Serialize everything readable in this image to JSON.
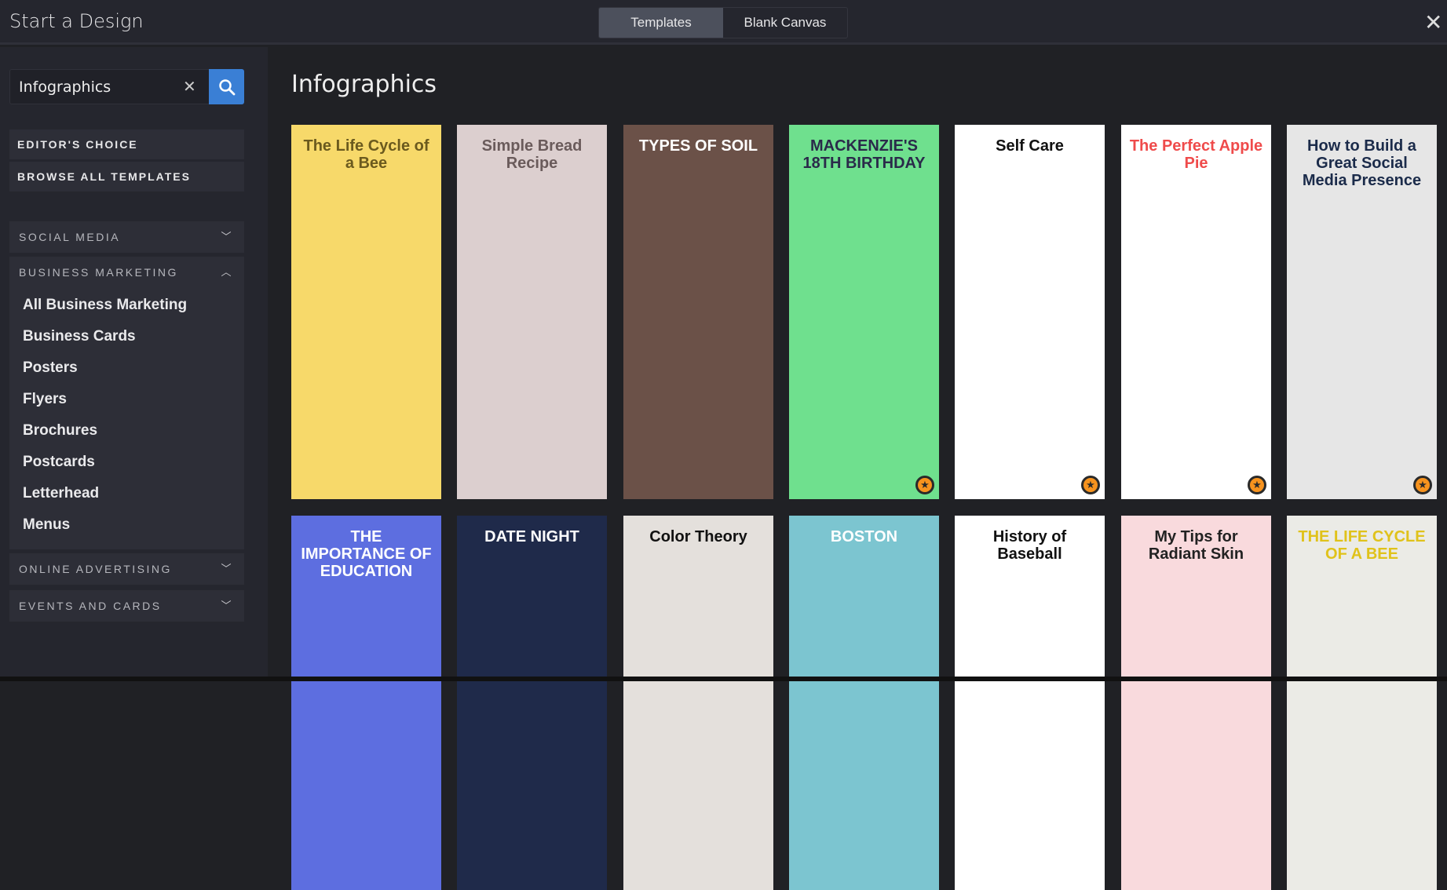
{
  "header": {
    "title": "Start a Design",
    "tabs": [
      {
        "label": "Templates",
        "active": true
      },
      {
        "label": "Blank Canvas",
        "active": false
      }
    ],
    "close": "✕"
  },
  "search": {
    "value": "Infographics",
    "clear": "✕"
  },
  "sidebar": {
    "editors_choice": "EDITOR'S CHOICE",
    "browse_all": "BROWSE ALL TEMPLATES",
    "sections": [
      {
        "label": "SOCIAL MEDIA",
        "expanded": false
      },
      {
        "label": "BUSINESS MARKETING",
        "expanded": true,
        "items": [
          "All Business Marketing",
          "Business Cards",
          "Posters",
          "Flyers",
          "Brochures",
          "Postcards",
          "Letterhead",
          "Menus"
        ]
      },
      {
        "label": "ONLINE ADVERTISING",
        "expanded": false
      },
      {
        "label": "EVENTS AND CARDS",
        "expanded": false
      }
    ]
  },
  "main": {
    "heading": "Infographics",
    "cards": [
      {
        "title": "The Life Cycle of a Bee",
        "bg": "#f7d96a",
        "fg": "#6b5a1e",
        "premium": false
      },
      {
        "title": "Simple Bread Recipe",
        "bg": "#dccfcf",
        "fg": "#6a5b5b",
        "premium": false
      },
      {
        "title": "TYPES OF SOIL",
        "bg": "#6b5148",
        "fg": "#ffffff",
        "premium": false
      },
      {
        "title": "MACKENZIE'S 18TH BIRTHDAY",
        "bg": "#6fe08e",
        "fg": "#2a2a4a",
        "premium": true
      },
      {
        "title": "Self Care",
        "bg": "#ffffff",
        "fg": "#111111",
        "premium": true
      },
      {
        "title": "The Perfect Apple Pie",
        "bg": "#ffffff",
        "fg": "#ef4b4b",
        "premium": true
      },
      {
        "title": "How to Build a Great Social Media Presence",
        "bg": "#e6e6e6",
        "fg": "#1b2b4a",
        "premium": true
      },
      {
        "title": "THE IMPORTANCE OF EDUCATION",
        "bg": "#5d6ee0",
        "fg": "#ffffff",
        "premium": false
      },
      {
        "title": "DATE NIGHT",
        "bg": "#1f2a4a",
        "fg": "#ffffff",
        "premium": false
      },
      {
        "title": "Color Theory",
        "bg": "#e4e0dc",
        "fg": "#111111",
        "premium": false
      },
      {
        "title": "BOSTON",
        "bg": "#7cc5d0",
        "fg": "#ffffff",
        "premium": false
      },
      {
        "title": "History of Baseball",
        "bg": "#ffffff",
        "fg": "#111111",
        "premium": false
      },
      {
        "title": "My Tips for Radiant Skin",
        "bg": "#f9dadd",
        "fg": "#222222",
        "premium": false
      },
      {
        "title": "THE LIFE CYCLE OF A BEE",
        "bg": "#ebebe6",
        "fg": "#e0c21a",
        "premium": false
      }
    ]
  }
}
